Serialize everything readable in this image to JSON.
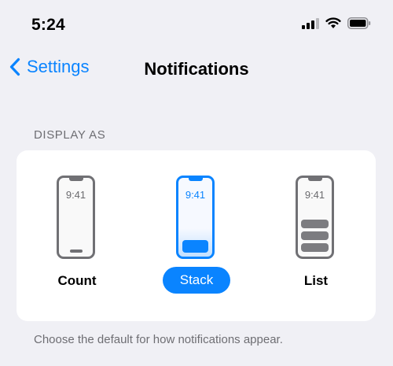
{
  "status_bar": {
    "time": "5:24",
    "icons": [
      "cellular-signal-icon",
      "wifi-icon",
      "battery-icon"
    ]
  },
  "nav": {
    "back_label": "Settings",
    "title": "Notifications"
  },
  "section": {
    "header": "DISPLAY AS",
    "footer": "Choose the default for how notifications appear."
  },
  "options": [
    {
      "label": "Count",
      "phone_time": "9:41",
      "selected": false
    },
    {
      "label": "Stack",
      "phone_time": "9:41",
      "selected": true
    },
    {
      "label": "List",
      "phone_time": "9:41",
      "selected": false
    }
  ],
  "colors": {
    "accent": "#0a84ff",
    "background": "#f0f0f5",
    "card": "#ffffff",
    "secondary_text": "#6e6e73"
  }
}
